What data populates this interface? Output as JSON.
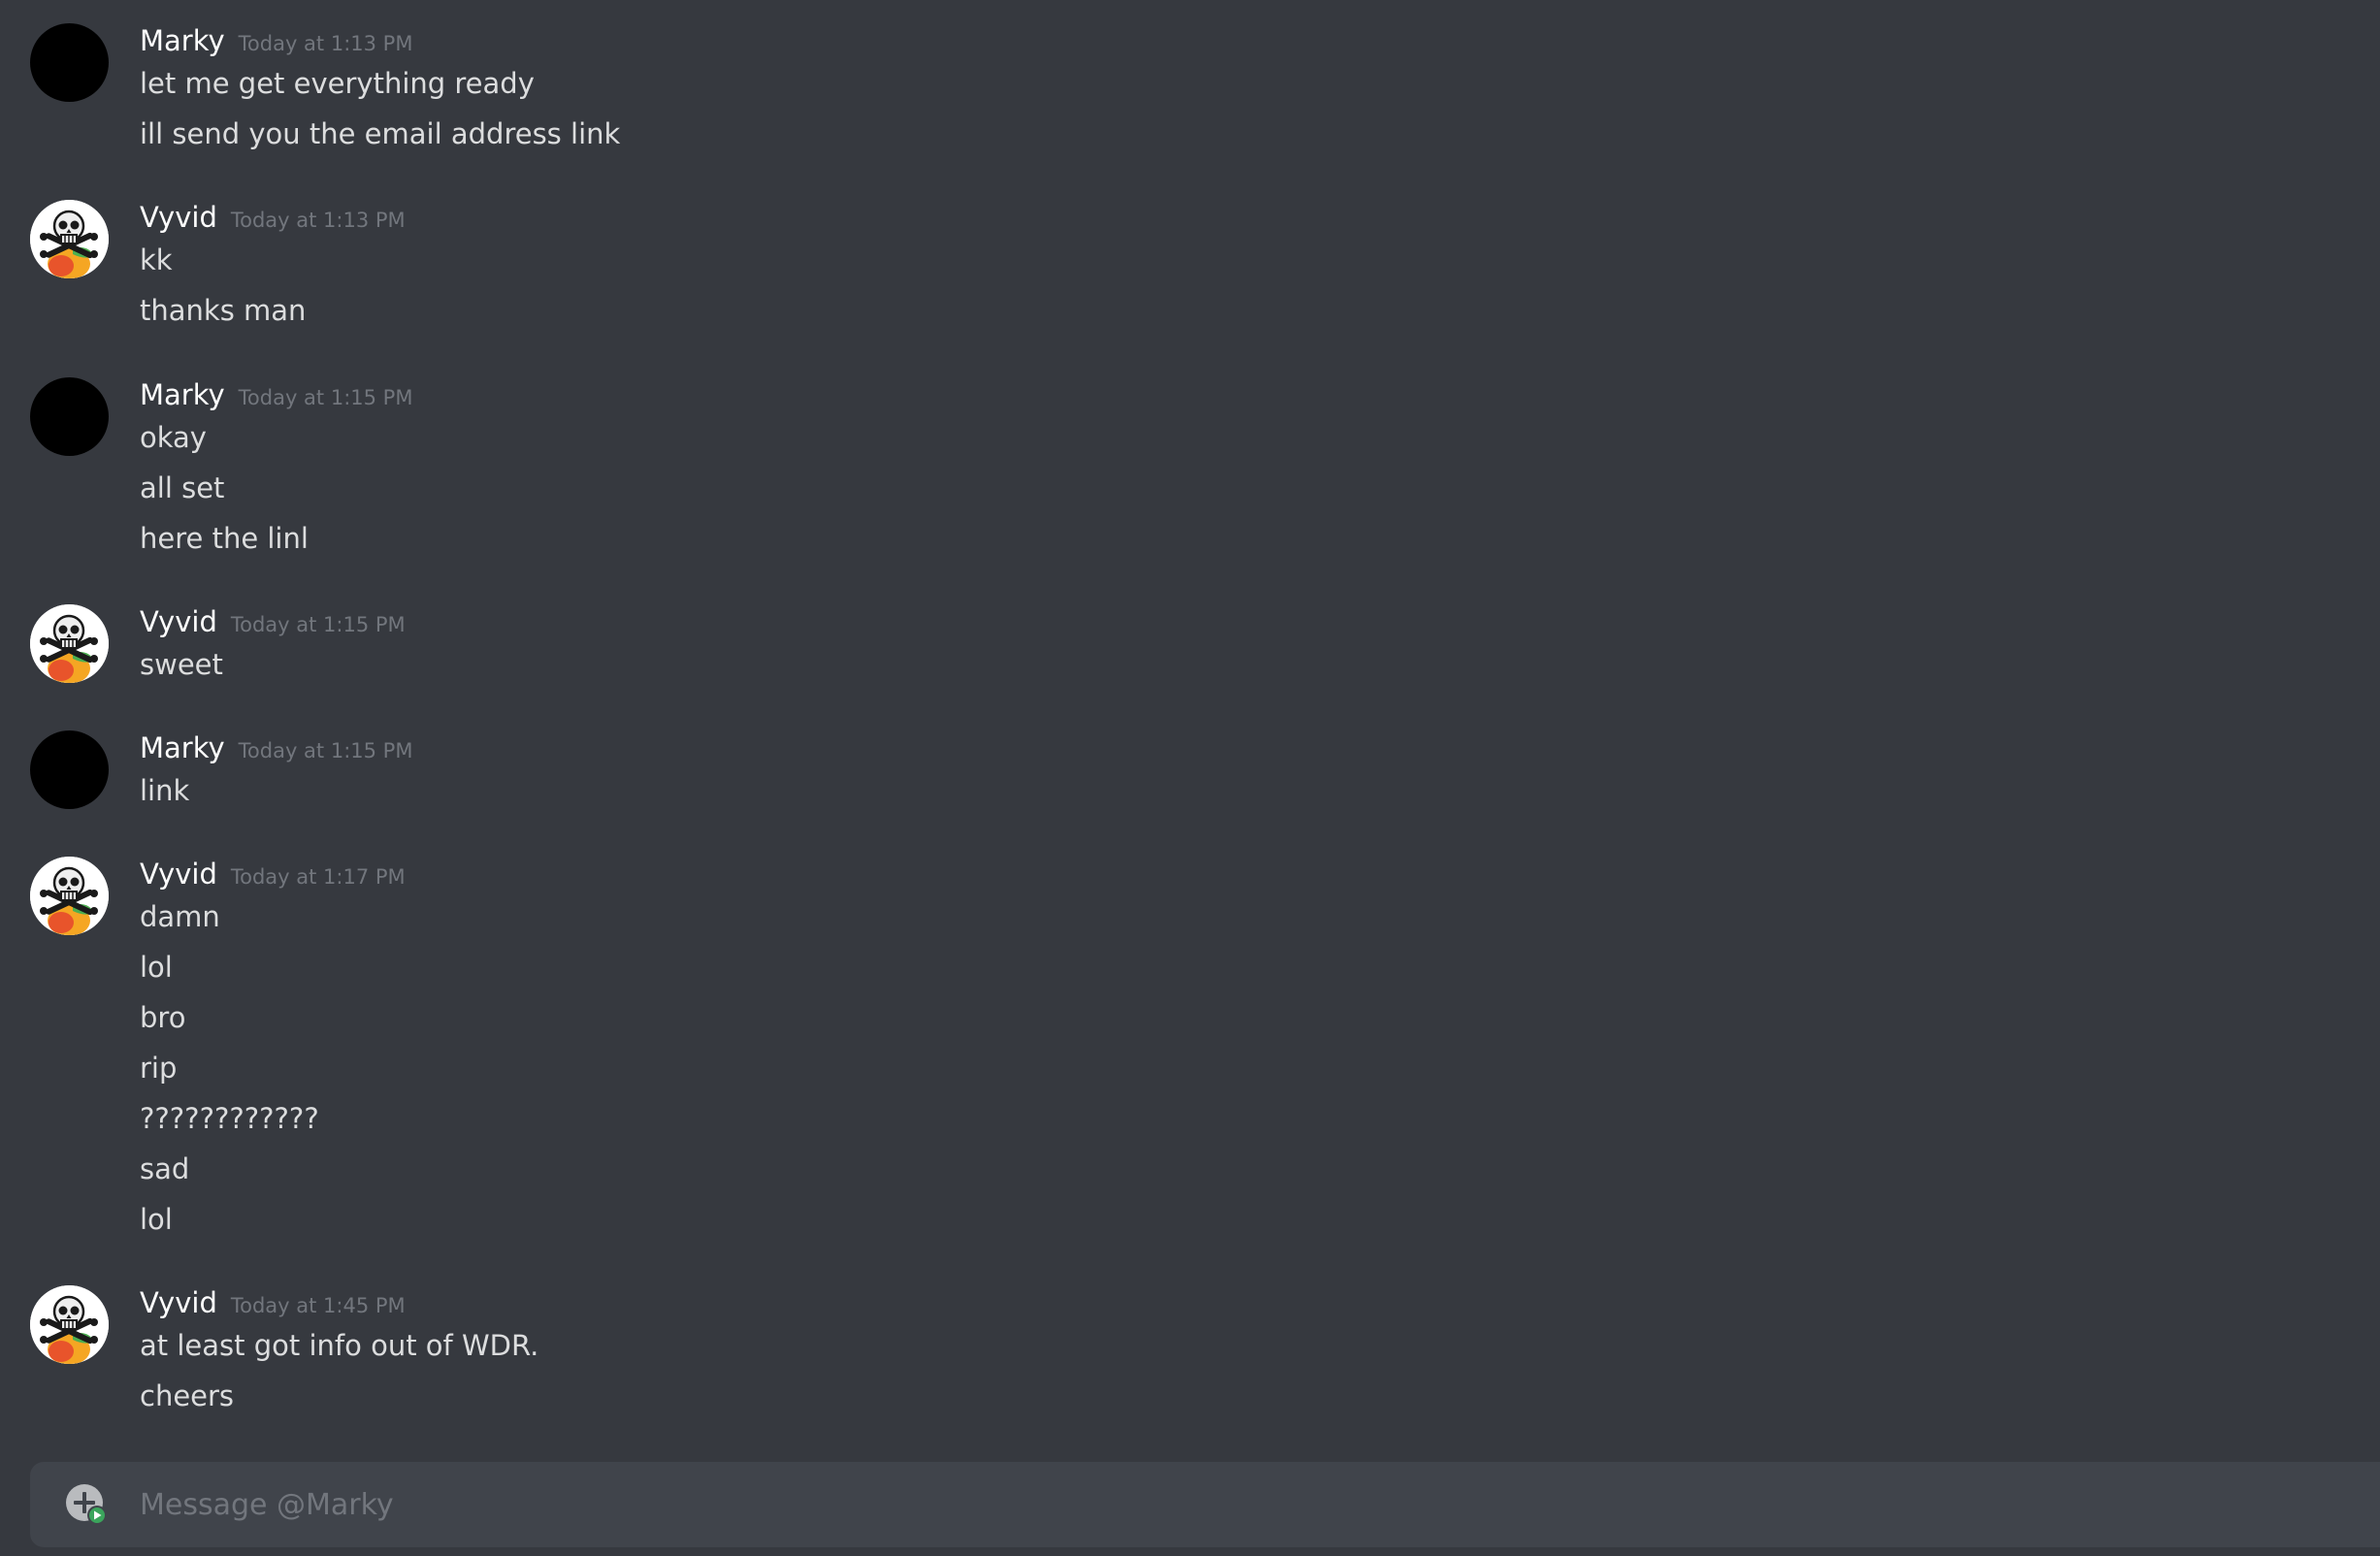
{
  "messages": [
    {
      "author": "Marky",
      "avatar": "black-avatar",
      "timestamp": "Today at 1:13 PM",
      "lines": [
        "let me get everything ready",
        "ill send you the email address link"
      ]
    },
    {
      "author": "Vyvid",
      "avatar": "skull-crossbones-avatar",
      "timestamp": "Today at 1:13 PM",
      "lines": [
        "kk",
        "thanks man"
      ]
    },
    {
      "author": "Marky",
      "avatar": "black-avatar",
      "timestamp": "Today at 1:15 PM",
      "lines": [
        "okay",
        "all set",
        "here the linl"
      ]
    },
    {
      "author": "Vyvid",
      "avatar": "skull-crossbones-avatar",
      "timestamp": "Today at 1:15 PM",
      "lines": [
        "sweet"
      ]
    },
    {
      "author": "Marky",
      "avatar": "black-avatar",
      "timestamp": "Today at 1:15 PM",
      "lines": [
        "link"
      ]
    },
    {
      "author": "Vyvid",
      "avatar": "skull-crossbones-avatar",
      "timestamp": "Today at 1:17 PM",
      "lines": [
        "damn",
        "lol",
        "bro",
        "rip",
        "????????????",
        "sad",
        "lol"
      ]
    },
    {
      "author": "Vyvid",
      "avatar": "skull-crossbones-avatar",
      "timestamp": "Today at 1:45 PM",
      "lines": [
        "at least got info out of WDR.",
        "cheers"
      ]
    }
  ],
  "composer": {
    "placeholder": "Message @Marky",
    "value": "",
    "attach_icon": "add-attachment-icon"
  },
  "colors": {
    "background": "#36393f",
    "composer_bg": "#40444b",
    "username": "#ffffff",
    "message_text": "#dcddde",
    "timestamp": "#72767d",
    "attach_badge": "#3ba55c"
  }
}
